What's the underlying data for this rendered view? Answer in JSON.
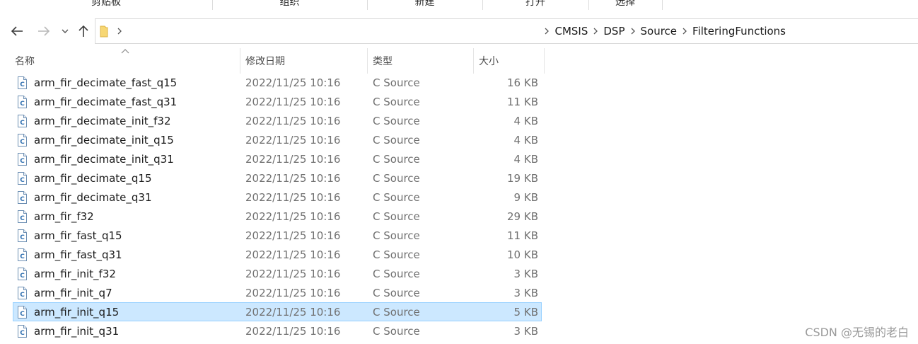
{
  "ribbon": {
    "groups": [
      "剪贴板",
      "组织",
      "新建",
      "打开",
      "选择"
    ]
  },
  "nav": {
    "back_icon": "arrow-left-icon",
    "forward_icon": "arrow-right-icon",
    "recent_icon": "chevron-down-icon",
    "up_icon": "arrow-up-icon",
    "breadcrumb_root_icon": "folder-icon",
    "breadcrumb": [
      "CMSIS",
      "DSP",
      "Source",
      "FilteringFunctions"
    ]
  },
  "columns": {
    "name": "名称",
    "modified": "修改日期",
    "type": "类型",
    "size": "大小"
  },
  "files": [
    {
      "name": "arm_fir_decimate_fast_q15",
      "modified": "2022/11/25 10:16",
      "type": "C Source",
      "size": "16 KB"
    },
    {
      "name": "arm_fir_decimate_fast_q31",
      "modified": "2022/11/25 10:16",
      "type": "C Source",
      "size": "11 KB"
    },
    {
      "name": "arm_fir_decimate_init_f32",
      "modified": "2022/11/25 10:16",
      "type": "C Source",
      "size": "4 KB"
    },
    {
      "name": "arm_fir_decimate_init_q15",
      "modified": "2022/11/25 10:16",
      "type": "C Source",
      "size": "4 KB"
    },
    {
      "name": "arm_fir_decimate_init_q31",
      "modified": "2022/11/25 10:16",
      "type": "C Source",
      "size": "4 KB"
    },
    {
      "name": "arm_fir_decimate_q15",
      "modified": "2022/11/25 10:16",
      "type": "C Source",
      "size": "19 KB"
    },
    {
      "name": "arm_fir_decimate_q31",
      "modified": "2022/11/25 10:16",
      "type": "C Source",
      "size": "9 KB"
    },
    {
      "name": "arm_fir_f32",
      "modified": "2022/11/25 10:16",
      "type": "C Source",
      "size": "29 KB"
    },
    {
      "name": "arm_fir_fast_q15",
      "modified": "2022/11/25 10:16",
      "type": "C Source",
      "size": "11 KB"
    },
    {
      "name": "arm_fir_fast_q31",
      "modified": "2022/11/25 10:16",
      "type": "C Source",
      "size": "10 KB"
    },
    {
      "name": "arm_fir_init_f32",
      "modified": "2022/11/25 10:16",
      "type": "C Source",
      "size": "3 KB"
    },
    {
      "name": "arm_fir_init_q7",
      "modified": "2022/11/25 10:16",
      "type": "C Source",
      "size": "3 KB"
    },
    {
      "name": "arm_fir_init_q15",
      "modified": "2022/11/25 10:16",
      "type": "C Source",
      "size": "5 KB",
      "selected": true
    },
    {
      "name": "arm_fir_init_q31",
      "modified": "2022/11/25 10:16",
      "type": "C Source",
      "size": "3 KB"
    }
  ],
  "file_icon": "c-source-file-icon",
  "colors": {
    "selection_bg": "#cce8ff",
    "selection_border": "#99d1ff",
    "secondary_text": "#707070"
  },
  "watermark": "CSDN @无锡的老白"
}
